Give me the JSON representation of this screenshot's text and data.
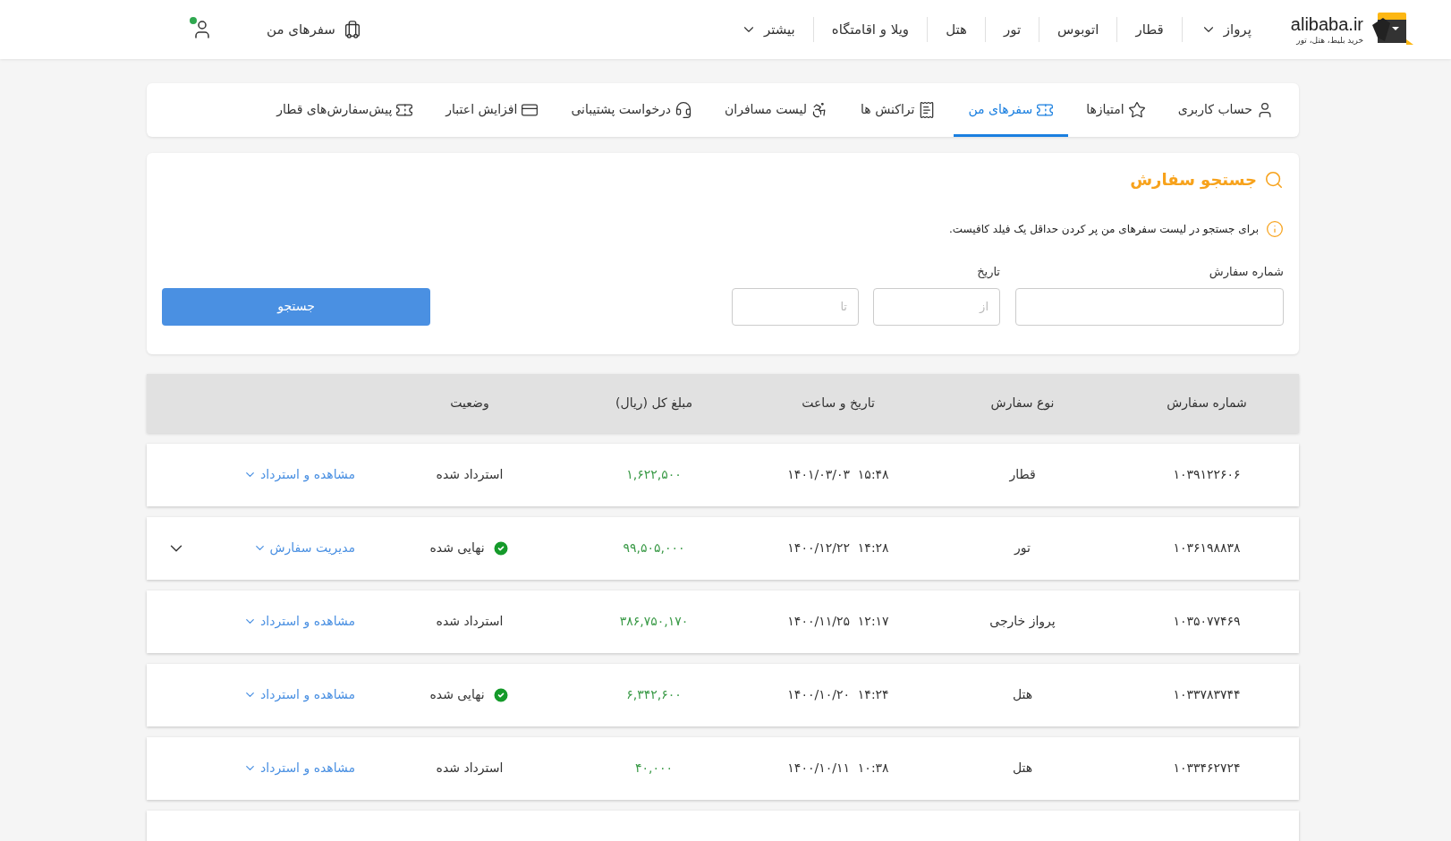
{
  "header": {
    "logo": {
      "name": "alibaba.ir",
      "tagline": "خرید بلیط، هتل، تور"
    },
    "nav": [
      {
        "label": "پرواز",
        "dropdown": true
      },
      {
        "label": "قطار",
        "dropdown": false
      },
      {
        "label": "اتوبوس",
        "dropdown": false
      },
      {
        "label": "تور",
        "dropdown": false
      },
      {
        "label": "هتل",
        "dropdown": false
      },
      {
        "label": "ویلا و اقامتگاه",
        "dropdown": false
      },
      {
        "label": "بیشتر",
        "dropdown": true
      }
    ],
    "my_trips": "سفرهای من",
    "account_verified": true
  },
  "tabs": [
    {
      "label": "حساب کاربری",
      "selected": false
    },
    {
      "label": "امتیازها",
      "selected": false
    },
    {
      "label": "سفرهای من",
      "selected": true
    },
    {
      "label": "تراکنش ها",
      "selected": false
    },
    {
      "label": "لیست مسافران",
      "selected": false
    },
    {
      "label": "درخواست پشتیبانی",
      "selected": false
    },
    {
      "label": "افزایش اعتبار",
      "selected": false
    },
    {
      "label": "پیش‌سفارش‌های قطار",
      "selected": false
    }
  ],
  "search": {
    "title": "جستجو سفارش",
    "hint": "برای جستجو در لیست سفرهای من پر کردن حداقل یک فیلد کافیست.",
    "order_label": "شماره سفارش",
    "date_label": "تاریخ",
    "from_placeholder": "از",
    "to_placeholder": "تا",
    "button": "جستجو"
  },
  "table": {
    "columns": [
      "شماره سفارش",
      "نوع سفارش",
      "تاریخ و ساعت",
      "مبلغ کل (ریال)",
      "وضعیت"
    ],
    "rows": [
      {
        "order": "۱۰۳۹۱۲۲۶۰۶",
        "type": "قطار",
        "datetime": "۱۵:۴۸  ۱۴۰۱/۰۳/۰۳",
        "amount": "۱,۶۲۲,۵۰۰",
        "status": {
          "text": "استرداد شده",
          "kind": "refunded"
        },
        "action": "مشاهده و استرداد",
        "expandable": false
      },
      {
        "order": "۱۰۳۶۱۹۸۸۳۸",
        "type": "تور",
        "datetime": "۱۴:۲۸  ۱۴۰۰/۱۲/۲۲",
        "amount": "۹۹,۵۰۵,۰۰۰",
        "status": {
          "text": "نهایی شده",
          "kind": "final"
        },
        "action": "مدیریت سفارش",
        "expandable": true
      },
      {
        "order": "۱۰۳۵۰۷۷۴۶۹",
        "type": "پرواز خارجی",
        "datetime": "۱۲:۱۷  ۱۴۰۰/۱۱/۲۵",
        "amount": "۳۸۶,۷۵۰,۱۷۰",
        "status": {
          "text": "استرداد شده",
          "kind": "refunded"
        },
        "action": "مشاهده و استرداد",
        "expandable": false
      },
      {
        "order": "۱۰۳۳۷۸۳۷۴۴",
        "type": "هتل",
        "datetime": "۱۴:۲۴  ۱۴۰۰/۱۰/۲۰",
        "amount": "۶,۳۴۲,۶۰۰",
        "status": {
          "text": "نهایی شده",
          "kind": "final"
        },
        "action": "مشاهده و استرداد",
        "expandable": false
      },
      {
        "order": "۱۰۳۳۴۶۲۷۲۴",
        "type": "هتل",
        "datetime": "۱۰:۳۸  ۱۴۰۰/۱۰/۱۱",
        "amount": "۴۰,۰۰۰",
        "status": {
          "text": "استرداد شده",
          "kind": "refunded"
        },
        "action": "مشاهده و استرداد",
        "expandable": false
      }
    ]
  }
}
